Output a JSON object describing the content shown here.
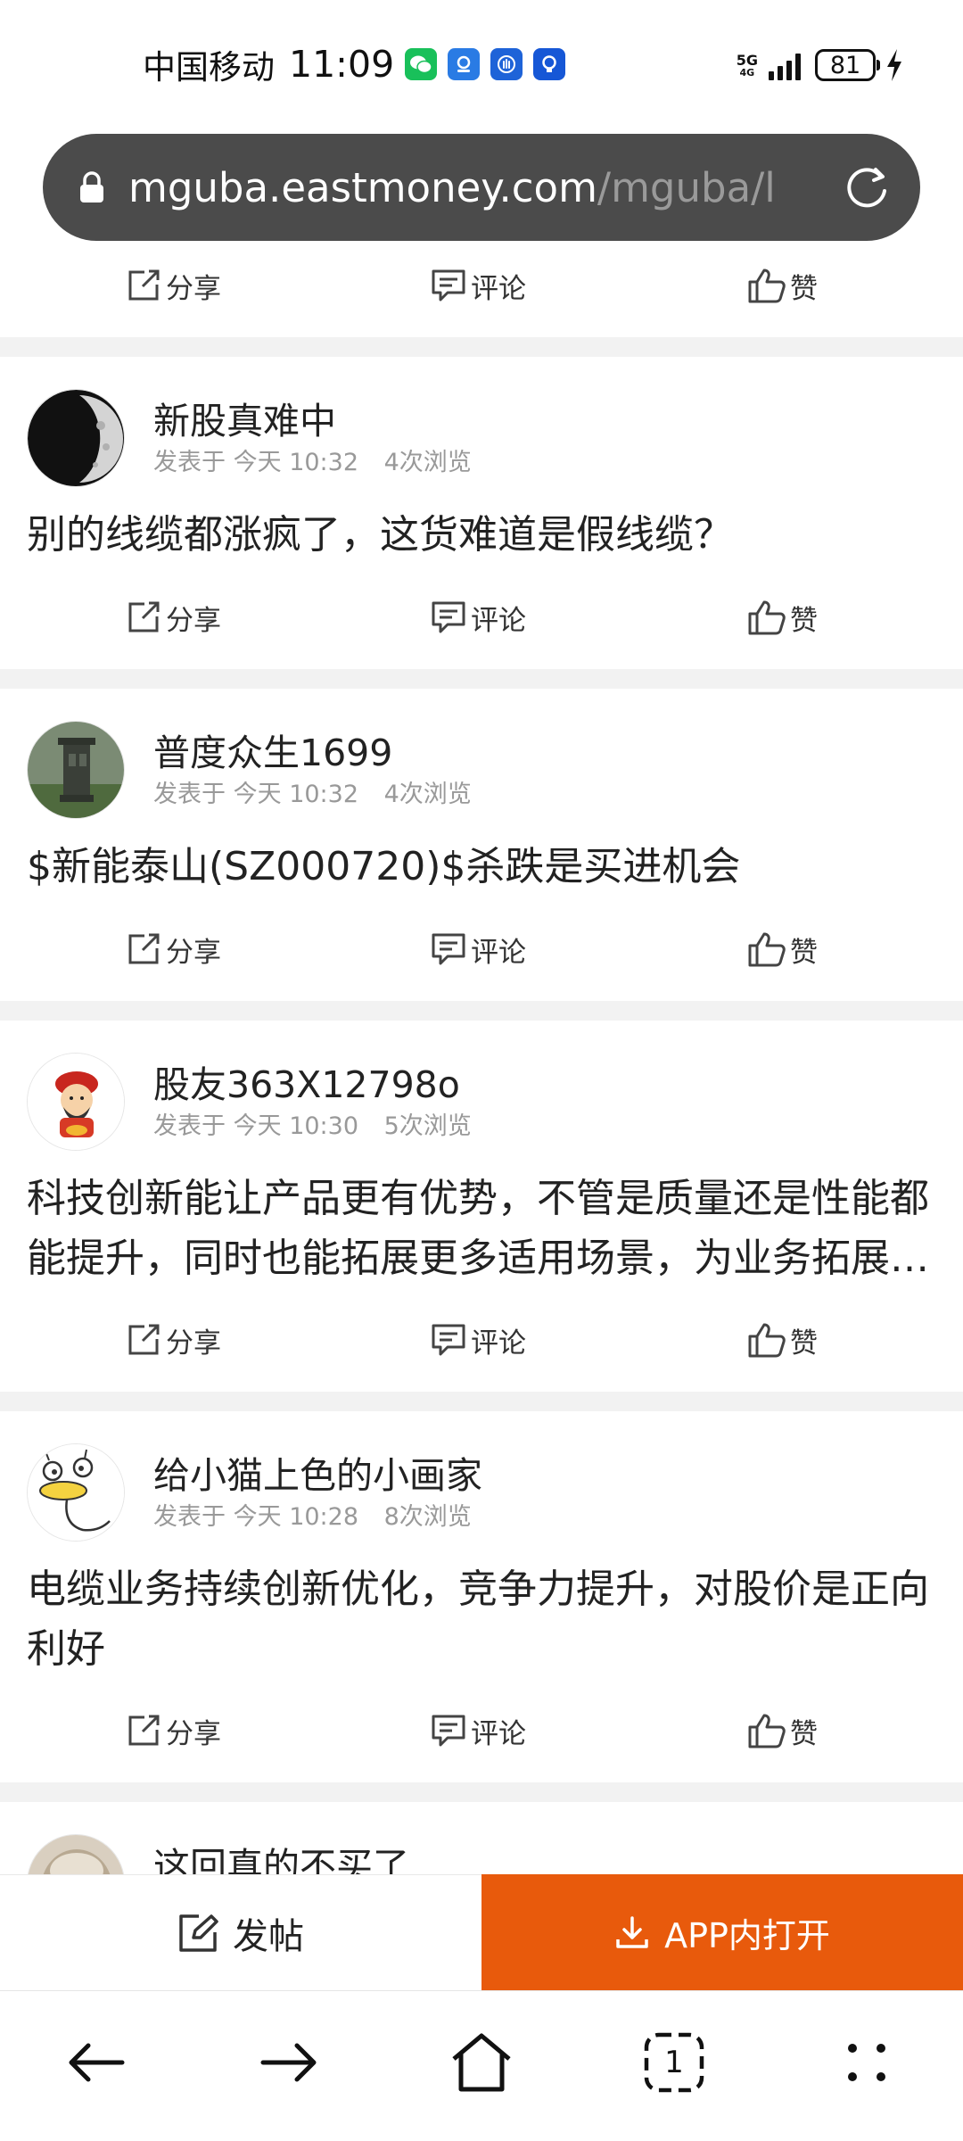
{
  "status_bar": {
    "carrier": "中国移动",
    "time": "11:09",
    "network": "5G",
    "network_sub": "4G",
    "battery": "81",
    "notification_icons": [
      "wechat-icon",
      "assistant-icon",
      "hand-icon",
      "bulb-icon"
    ]
  },
  "browser": {
    "url_domain": "mguba.eastmoney.com",
    "url_path": "/mguba/lis",
    "tab_count": "1"
  },
  "actions": {
    "share": "分享",
    "comment": "评论",
    "like": "赞"
  },
  "posts": [
    {
      "author": "新股真难中",
      "meta_prefix": "发表于",
      "date": "今天",
      "time": "10:32",
      "views": "4次浏览",
      "content": "别的线缆都涨疯了，这货难道是假线缆？",
      "avatar": "moon-avatar"
    },
    {
      "author": "普度众生1699",
      "meta_prefix": "发表于",
      "date": "今天",
      "time": "10:32",
      "views": "4次浏览",
      "content": "$新能泰山(SZ000720)$杀跌是买进机会",
      "avatar": "landscape-avatar"
    },
    {
      "author": "股友363X12798o",
      "meta_prefix": "发表于",
      "date": "今天",
      "time": "10:30",
      "views": "5次浏览",
      "content": "科技创新能让产品更有优势，不管是质量还是性能都能提升，同时也能拓展更多适用场景，为业务拓展提供更多可能",
      "avatar": "fortune-god-avatar"
    },
    {
      "author": "给小猫上色的小画家",
      "meta_prefix": "发表于",
      "date": "今天",
      "time": "10:28",
      "views": "8次浏览",
      "content": "电缆业务持续创新优化，竞争力提升，对股价是正向利好",
      "avatar": "cartoon-bird-avatar"
    },
    {
      "author": "这回真的不买了",
      "avatar": "dog-avatar"
    }
  ],
  "bottom_bar": {
    "compose_label": "发帖",
    "open_app_label": "APP内打开",
    "accent_color": "#e85a0c"
  }
}
